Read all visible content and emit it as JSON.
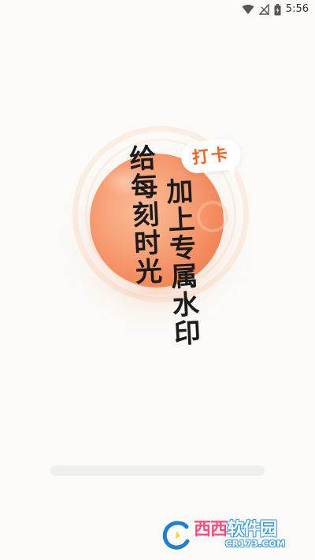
{
  "status_bar": {
    "time": "5:56",
    "icons": [
      "wifi-icon",
      "signal-icon",
      "battery-icon"
    ]
  },
  "splash": {
    "badge_text": "打卡",
    "slogan_left": "给每刻时光",
    "slogan_right": "加上专属水印",
    "colors": {
      "accent": "#f4621f",
      "ball": "#f8a47a",
      "text": "#1b1b1b"
    }
  },
  "loading": {
    "progress": 0
  },
  "watermark": {
    "brand_part1": "西西",
    "brand_part2": "软件园",
    "domain": "CR173.COM"
  }
}
